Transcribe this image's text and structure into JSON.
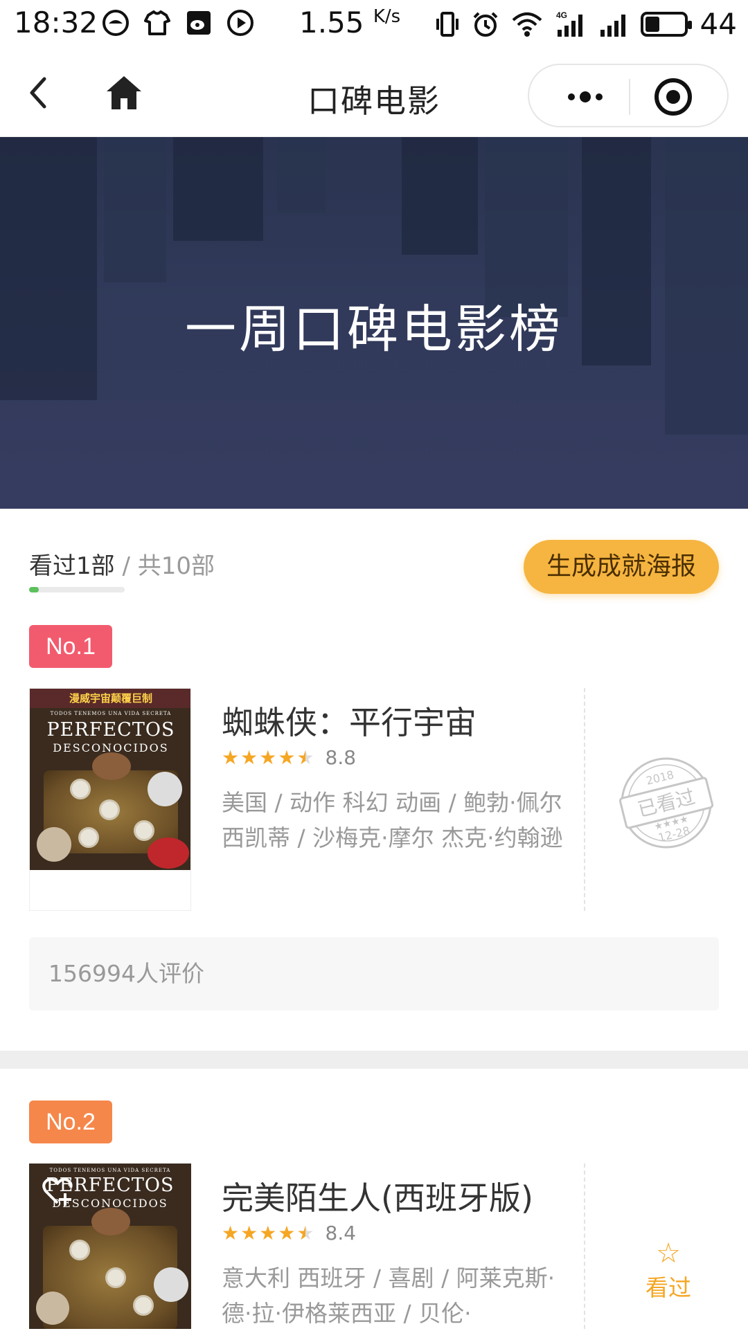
{
  "status_bar": {
    "time": "18:32",
    "net_speed": "1.55",
    "net_unit": "K/s",
    "network": "4G",
    "battery": "44",
    "battery_level": 0.44
  },
  "nav": {
    "title": "口碑电影",
    "back_icon": "chevron-left-icon",
    "home_icon": "home-icon",
    "more_icon": "more-dots-icon",
    "close_icon": "target-circle-icon"
  },
  "banner": {
    "title": "一周口碑电影榜"
  },
  "progress": {
    "watched_label": "看过1部",
    "separator": " / ",
    "total_label": "共10部",
    "fraction": 0.1,
    "button_label": "生成成就海报"
  },
  "movies": [
    {
      "rank": "No.1",
      "rank_color": "#f25b6e",
      "poster_strip": "漫威宇宙颠覆巨制",
      "poster_title": "PERFECTOS",
      "poster_subtitle": "DESCONOCIDOS",
      "poster_tagline": "TODOS TENEMOS UNA VIDA SECRETA",
      "title": "蜘蛛侠：平行宇宙",
      "rating_stars": 4.5,
      "score": "8.8",
      "meta": "美国 / 动作 科幻 动画 / 鲍勃·佩尔西凯蒂 / 沙梅克·摩尔 杰克·约翰逊",
      "stamp": {
        "year": "2018",
        "text": "已看过",
        "date": "12-28"
      },
      "review_count": "156994人评价"
    },
    {
      "rank": "No.2",
      "rank_color": "#f5874a",
      "poster_title": "PERFECTOS",
      "poster_subtitle": "DESCONOCIDOS",
      "poster_tagline": "TODOS TENEMOS UNA VIDA SECRETA",
      "title": "完美陌生人(西班牙版)",
      "rating_stars": 4.5,
      "score": "8.4",
      "meta": "意大利 西班牙 / 喜剧 / 阿莱克斯·德·拉·伊格莱西亚 / 贝伦·",
      "seen_label": "看过",
      "seen_icon": "star-outline-icon",
      "favorite_icon": "heart-plus-icon"
    }
  ],
  "colors": {
    "accent": "#f6b540",
    "progress": "#5cc05c",
    "star": "#f5a623",
    "banner_bg": "#323a5a"
  }
}
